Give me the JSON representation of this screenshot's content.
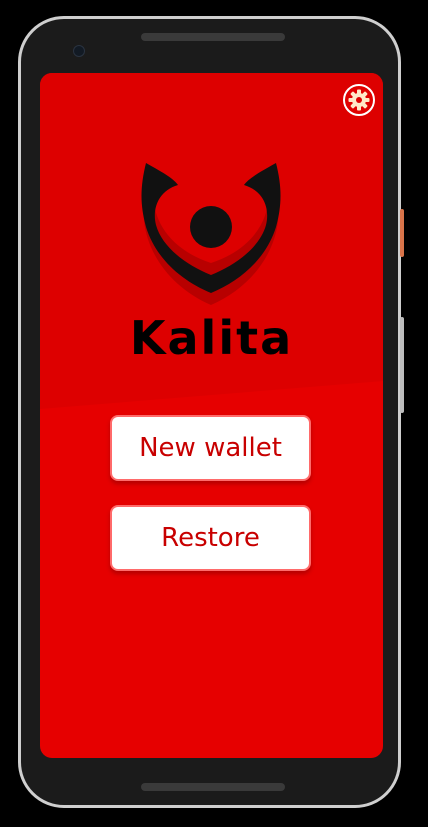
{
  "app": {
    "name": "Kalita"
  },
  "colors": {
    "background": "#e60000",
    "background_top": "#dd0000",
    "button_text": "#c80000",
    "button_bg": "#ffffff",
    "logo_dark": "#111111",
    "logo_shadow": "#b80000"
  },
  "header": {
    "settings_icon": "gear-icon"
  },
  "actions": {
    "new_wallet_label": "New wallet",
    "restore_label": "Restore"
  }
}
